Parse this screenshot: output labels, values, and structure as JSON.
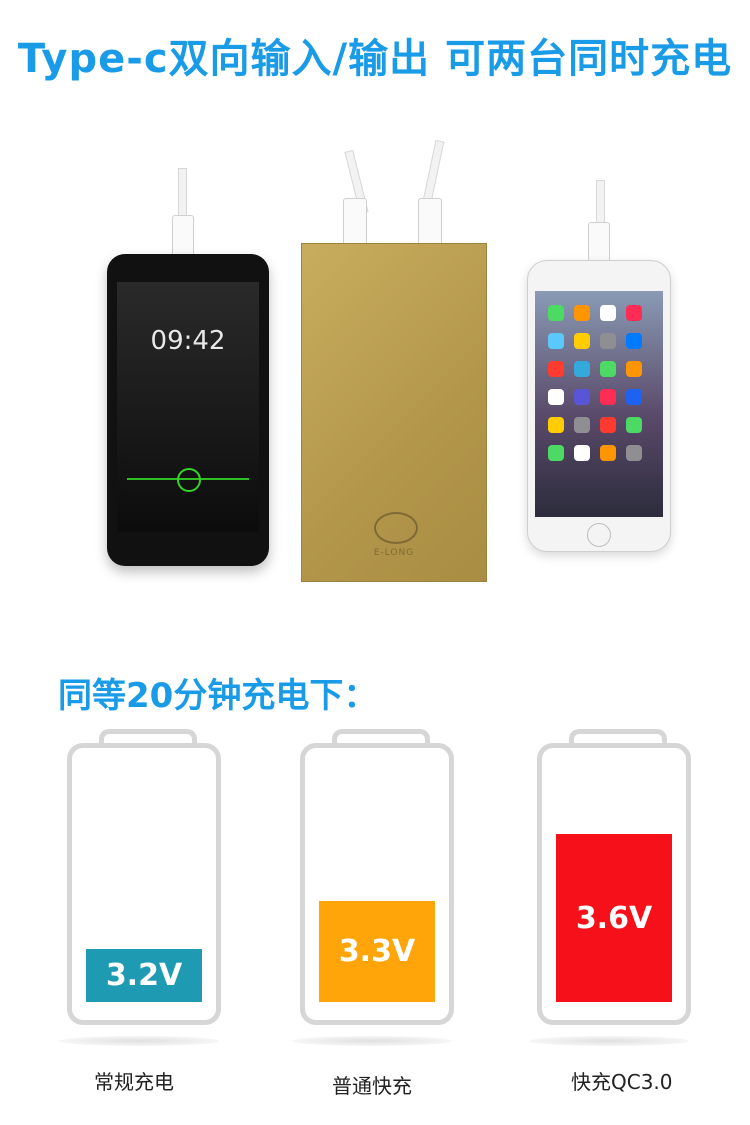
{
  "headline": "Type-c双向输入/输出 可两台同时充电",
  "photo": {
    "android_clock": "09:42",
    "powerbank_brand": "E-LONG"
  },
  "comparison": {
    "heading": "同等20分钟充电下：",
    "batteries": [
      {
        "caption": "常规充电",
        "voltage": "3.2V",
        "fill_color": "#1f9ab3",
        "fill_level": 0.22
      },
      {
        "caption": "普通快充",
        "voltage": "3.3V",
        "fill_color": "#ffa50a",
        "fill_level": 0.42
      },
      {
        "caption": "快充QC3.0",
        "voltage": "3.6V",
        "fill_color": "#f5101a",
        "fill_level": 0.7
      }
    ]
  }
}
